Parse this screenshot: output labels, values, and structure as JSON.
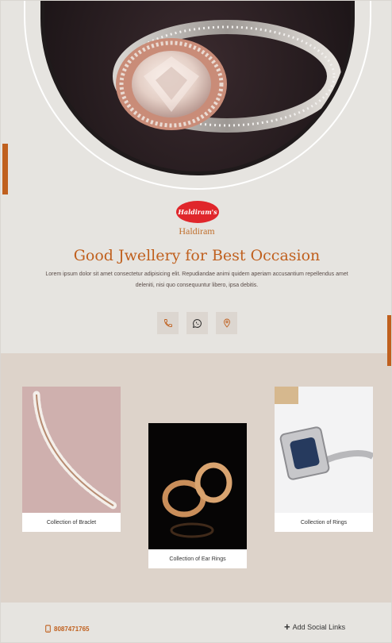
{
  "brand": {
    "logo_text": "Haldiram's",
    "name": "Haldiram"
  },
  "hero": {
    "headline": "Good Jwellery for Best Occasion",
    "description": "Lorem ipsum dolor sit amet consectetur adipisicing elit. Repudiandae animi quidem aperiam accusantium repellendus amet deleniti, nisi quo consequuntur libero, ipsa debitis."
  },
  "contacts": {
    "icons": [
      "phone-icon",
      "whatsapp-icon",
      "location-pin-icon"
    ]
  },
  "collections": [
    {
      "caption": "Collection of Braclet"
    },
    {
      "caption": "Collection of Ear Rings"
    },
    {
      "caption": "Collection of Rings"
    }
  ],
  "footer": {
    "phone": "8087471765",
    "social_label": "Add Social Links"
  },
  "colors": {
    "accent": "#c0601e",
    "background": "#e6e4e0",
    "band": "#ddd3ca",
    "logo_red": "#e0262b"
  }
}
